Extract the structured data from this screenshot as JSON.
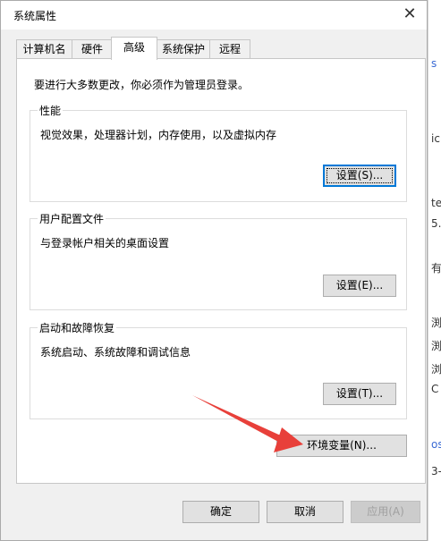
{
  "window": {
    "title": "系统属性",
    "close_glyph": "✕"
  },
  "tabs": [
    {
      "label": "计算机名",
      "active": false
    },
    {
      "label": "硬件",
      "active": false
    },
    {
      "label": "高级",
      "active": true
    },
    {
      "label": "系统保护",
      "active": false
    },
    {
      "label": "远程",
      "active": false
    }
  ],
  "advanced": {
    "admin_note": "要进行大多数更改，你必须作为管理员登录。",
    "performance": {
      "title": "性能",
      "desc": "视觉效果，处理器计划，内存使用，以及虚拟内存",
      "button": "设置(S)..."
    },
    "user_profiles": {
      "title": "用户配置文件",
      "desc": "与登录帐户相关的桌面设置",
      "button": "设置(E)..."
    },
    "startup_recovery": {
      "title": "启动和故障恢复",
      "desc": "系统启动、系统故障和调试信息",
      "button": "设置(T)..."
    },
    "env_button": "环境变量(N)..."
  },
  "footer": {
    "ok": "确定",
    "cancel": "取消",
    "apply": "应用(A)"
  },
  "background_fragments": [
    "s",
    "ic",
    "te",
    "5.",
    "有",
    "渕",
    "渕",
    "浏",
    "C",
    "os",
    "3-"
  ],
  "colors": {
    "arrow": "#e8403a",
    "focus": "#0078d7",
    "window_bg": "#f0f0f0"
  }
}
